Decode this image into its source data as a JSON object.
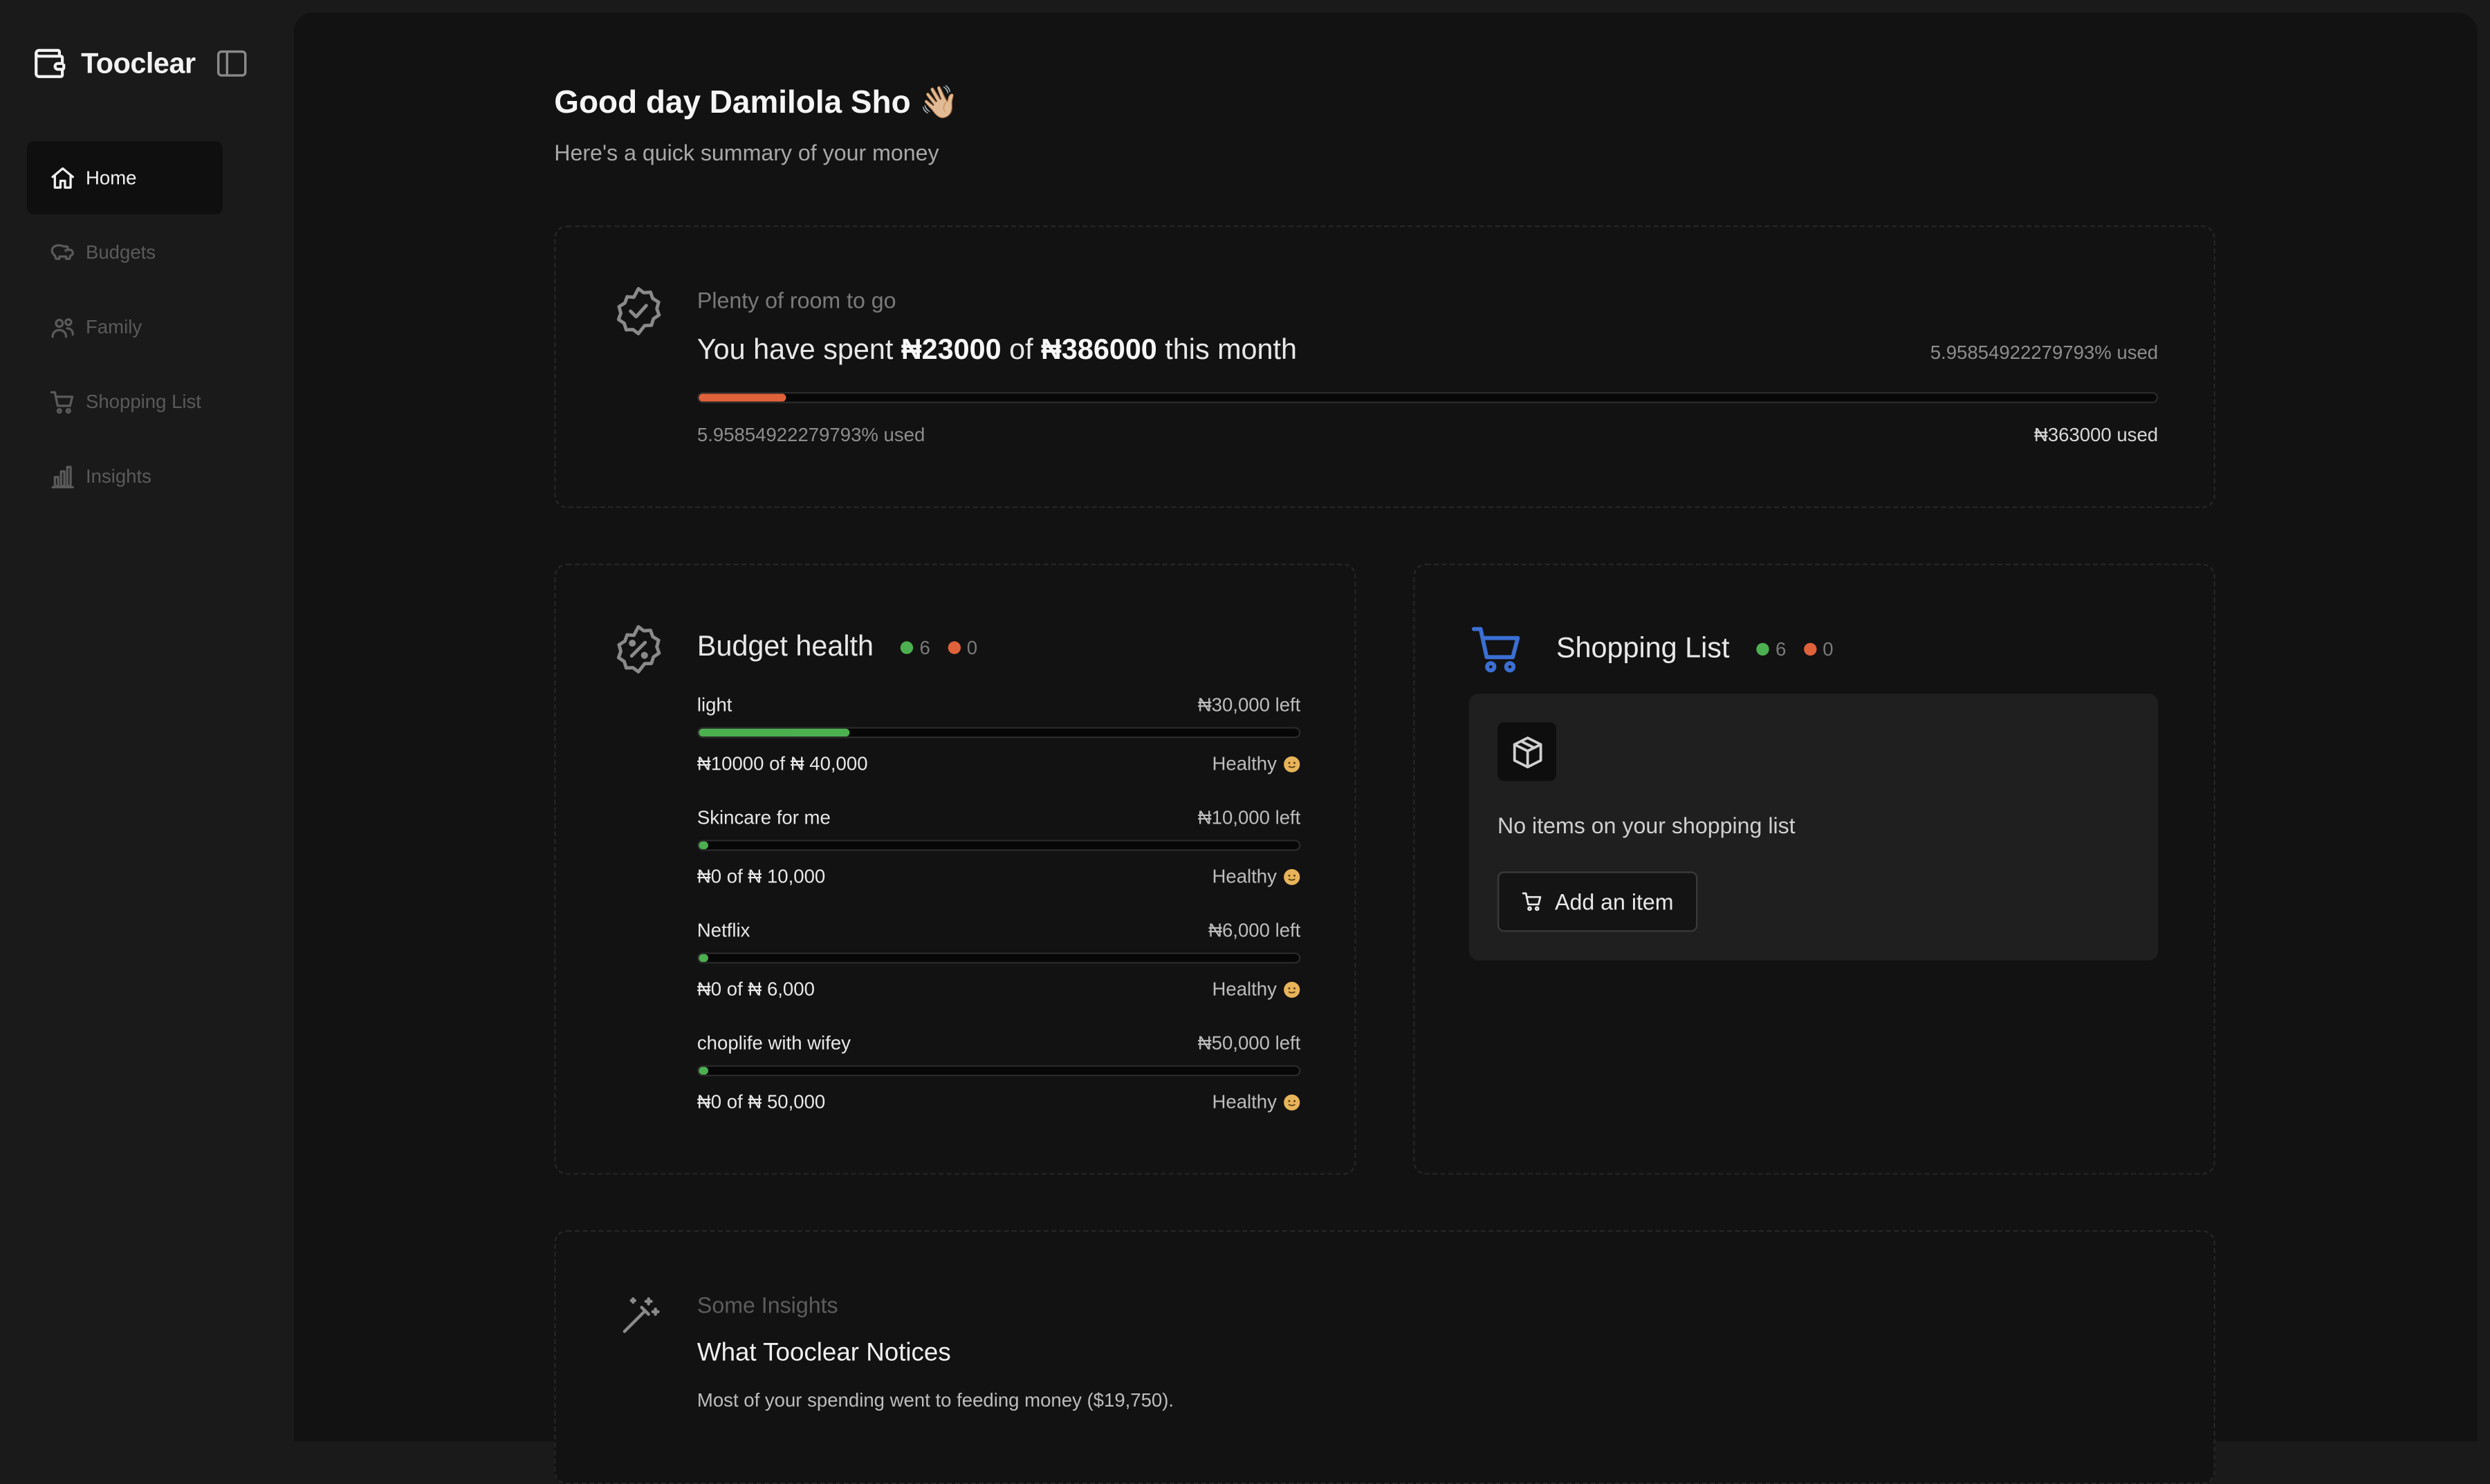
{
  "app": {
    "name": "Tooclear"
  },
  "sidebar": {
    "items": [
      {
        "label": "Home",
        "icon": "home-icon",
        "active": true
      },
      {
        "label": "Budgets",
        "icon": "piggy-bank-icon"
      },
      {
        "label": "Family",
        "icon": "users-icon"
      },
      {
        "label": "Shopping List",
        "icon": "cart-icon"
      },
      {
        "label": "Insights",
        "icon": "bar-chart-icon"
      }
    ]
  },
  "header": {
    "greeting": "Good day Damilola Sho 👋🏼",
    "subtitle": "Here's a quick summary of your money"
  },
  "spending": {
    "status": "Plenty of room to go",
    "prefix": "You have spent ",
    "spent": "₦23000",
    "of": " of ",
    "total": "₦386000",
    "suffix": " this month",
    "used_pct_text": "5.95854922279793% used",
    "foot_left": "5.95854922279793% used",
    "foot_right": "₦363000 used",
    "progress": 0.0596
  },
  "budget_health": {
    "title": "Budget health",
    "good_count": "6",
    "bad_count": "0",
    "items": [
      {
        "name": "light",
        "left": "₦30,000 left",
        "amount": "₦10000 of ₦ 40,000",
        "status": "Healthy",
        "progress": 0.25
      },
      {
        "name": "Skincare for me",
        "left": "₦10,000 left",
        "amount": "₦0 of ₦ 10,000",
        "status": "Healthy",
        "progress": 0
      },
      {
        "name": "Netflix",
        "left": "₦6,000 left",
        "amount": "₦0 of ₦ 6,000",
        "status": "Healthy",
        "progress": 0
      },
      {
        "name": "choplife with wifey",
        "left": "₦50,000 left",
        "amount": "₦0 of ₦ 50,000",
        "status": "Healthy",
        "progress": 0
      }
    ]
  },
  "shopping_list": {
    "title": "Shopping List",
    "good_count": "6",
    "bad_count": "0",
    "empty_text": "No items on your shopping list",
    "add_label": "Add an item"
  },
  "insights": {
    "label": "Some Insights",
    "title": "What Tooclear Notices",
    "text": "Most of your spending went to feeding money ($19,750)."
  },
  "colors": {
    "accent_orange": "#e0623a",
    "accent_green": "#4caf50",
    "cart_blue": "#3b6fd4",
    "smiley": "#e8b45a"
  }
}
